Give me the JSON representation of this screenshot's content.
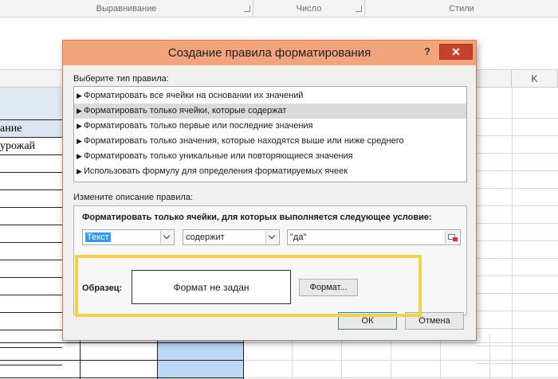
{
  "ribbon": {
    "groups": [
      {
        "label": "Выравнивание"
      },
      {
        "label": "Число"
      },
      {
        "label": "Стили"
      }
    ]
  },
  "sheet": {
    "column_header": "K",
    "cells": [
      "ание",
      "урожай"
    ]
  },
  "dialog": {
    "title": "Создание правила форматирования",
    "help": "?",
    "close": "✕",
    "rule_type_label": "Выберите тип правила:",
    "rule_types": [
      "Форматировать все ячейки на основании их значений",
      "Форматировать только ячейки, которые содержат",
      "Форматировать только первые или последние значения",
      "Форматировать только значения, которые находятся выше или ниже среднего",
      "Форматировать только уникальные или повторяющиеся значения",
      "Использовать формулу для определения форматируемых ячеек"
    ],
    "selected_rule_index": 1,
    "description_label": "Измените описание правила:",
    "condition_label": "Форматировать только ячейки, для которых выполняется следующее условие:",
    "condition_type": "Текст",
    "operator": "содержит",
    "value": "\"да\"",
    "sample_label": "Образец:",
    "sample_text": "Формат не задан",
    "format_button": "Формат...",
    "ok_button": "ОК",
    "cancel_button": "Отмена"
  },
  "colors": {
    "titlebar": "#f2a57c",
    "close_button": "#c7402c",
    "highlight": "#f3d24a",
    "selected_column": "#bcd8f4"
  }
}
